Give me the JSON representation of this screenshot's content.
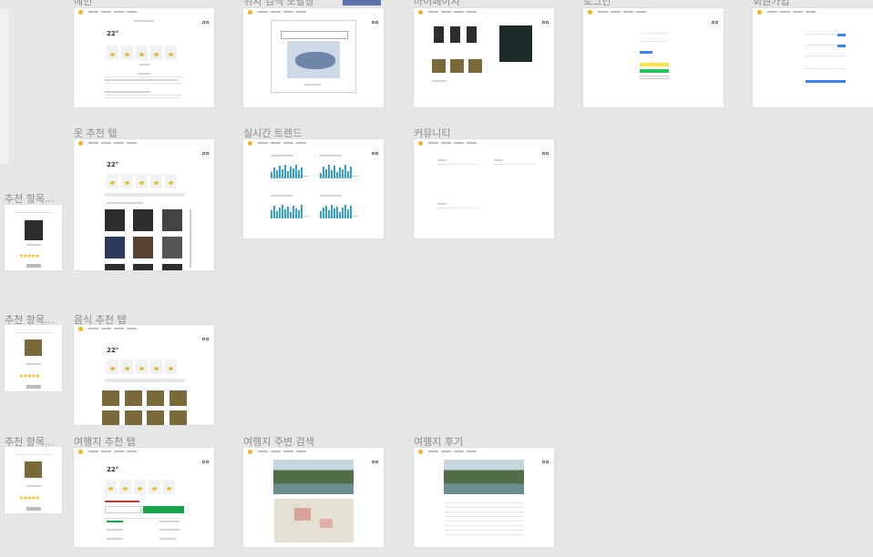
{
  "labels": {
    "main": "메인",
    "search_partial": "위치 검색 모달창",
    "mypage": "마이페이지",
    "login": "로그인",
    "signup": "회원가입",
    "clothes_tab": "옷 추천 탭",
    "trend": "실시간 트렌드",
    "community": "커뮤니티",
    "item1": "추천 항목...",
    "food_tab": "음식 추천 탭",
    "item2": "추천 항목...",
    "item3": "추천 항목...",
    "travel_tab": "여행지 추천 탭",
    "travel_search": "여행지 주변 검색",
    "travel_review": "여행지 후기"
  },
  "selected_badge": "로그인",
  "weather": {
    "temp": "22°"
  },
  "stars": "★★★★★",
  "colors": {
    "canvas": "#e6e6e6",
    "accent": "#f0b323",
    "chart": "#36a2c9",
    "green": "#16a34a",
    "selection": "#5b6fa8"
  },
  "icons": [
    "sun-logo-icon",
    "user-icon",
    "logout-icon",
    "search-icon",
    "map-pin-icon"
  ]
}
